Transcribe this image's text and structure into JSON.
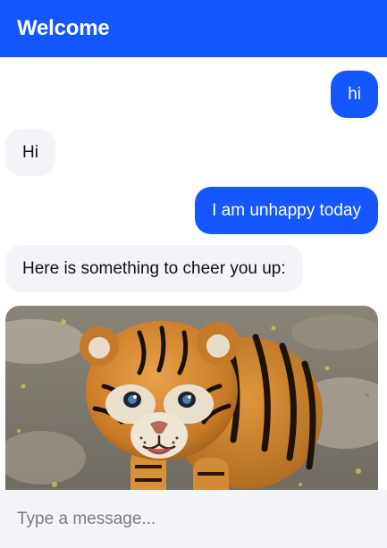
{
  "header": {
    "title": "Welcome"
  },
  "messages": [
    {
      "role": "user",
      "text": "hi"
    },
    {
      "role": "bot",
      "text": "Hi"
    },
    {
      "role": "user",
      "text": "I am unhappy today"
    },
    {
      "role": "bot",
      "text": "Here is something to cheer you up:"
    }
  ],
  "image": {
    "subject": "tiger cub photo",
    "icon": "image"
  },
  "composer": {
    "placeholder": "Type a message..."
  },
  "colors": {
    "accent": "#1557ff",
    "bot_bubble": "#f2f4f7",
    "composer_bg": "#f2f4f7"
  }
}
